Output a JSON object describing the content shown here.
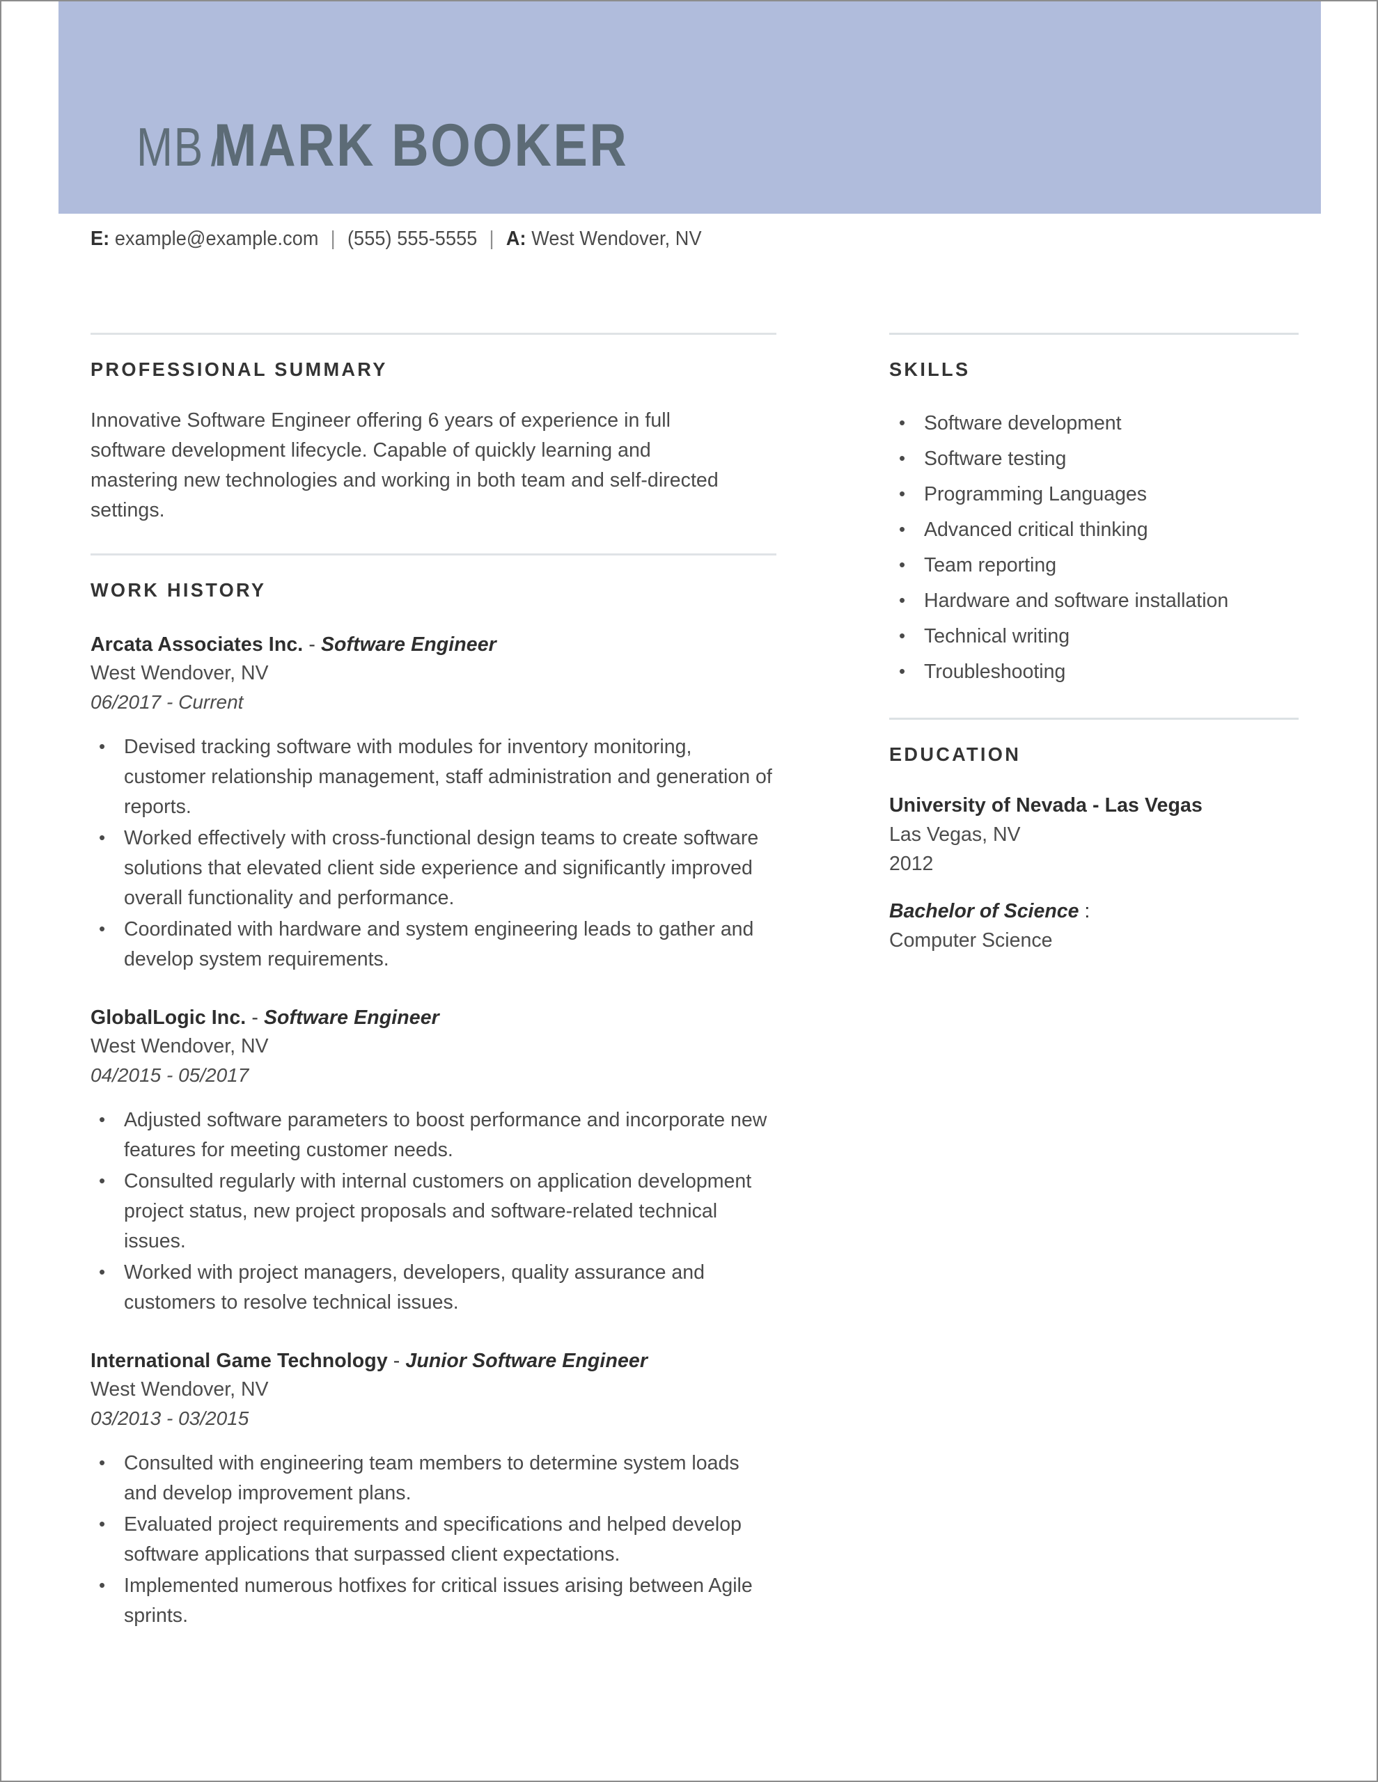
{
  "header": {
    "initials": "MB",
    "separator": "/",
    "full_name": "MARK BOOKER",
    "band_color": "#b0bcdc",
    "name_color": "#5c6b76"
  },
  "contact": {
    "email_label": "E:",
    "email": "example@example.com",
    "sep1": "|",
    "phone": "(555) 555-5555",
    "sep2": "|",
    "address_label": "A:",
    "address": "West Wendover, NV"
  },
  "sections": {
    "professional_summary": {
      "title": "PROFESSIONAL SUMMARY",
      "body": "Innovative Software Engineer offering 6 years of experience in full software development lifecycle. Capable of quickly learning and mastering new technologies and working in both team and self-directed settings."
    },
    "work_history": {
      "title": "WORK HISTORY",
      "jobs": [
        {
          "company": "Arcata Associates Inc.",
          "dash": " - ",
          "role": "Software Engineer",
          "location": "West Wendover, NV",
          "dates": "06/2017 - Current",
          "bullets": [
            "Devised tracking software with modules for inventory monitoring, customer relationship management, staff administration and generation of reports.",
            "Worked effectively with cross-functional design teams to create software solutions that elevated client side experience and significantly improved overall functionality and performance.",
            "Coordinated with hardware and system engineering leads to gather and develop system requirements."
          ]
        },
        {
          "company": "GlobalLogic Inc.",
          "dash": " - ",
          "role": "Software Engineer",
          "location": "West Wendover, NV",
          "dates": "04/2015 - 05/2017",
          "bullets": [
            "Adjusted software parameters to boost performance and incorporate new features for meeting customer needs.",
            "Consulted regularly with internal customers on application development project status, new project proposals and software-related technical issues.",
            "Worked with project managers, developers, quality assurance and customers to resolve technical issues."
          ]
        },
        {
          "company": "International Game Technology",
          "dash": " - ",
          "role": "Junior Software Engineer",
          "location": "West Wendover, NV",
          "dates": "03/2013 - 03/2015",
          "bullets": [
            "Consulted with engineering team members to determine system loads and develop improvement plans.",
            "Evaluated project requirements and specifications and helped develop software applications that surpassed client expectations.",
            "Implemented numerous hotfixes for critical issues arising between Agile sprints."
          ]
        }
      ]
    },
    "skills": {
      "title": "SKILLS",
      "items": [
        "Software development",
        "Software testing",
        "Programming Languages",
        "Advanced critical thinking",
        "Team reporting",
        "Hardware and software installation",
        "Technical writing",
        "Troubleshooting"
      ]
    },
    "education": {
      "title": "EDUCATION",
      "school": "University of Nevada - Las Vegas",
      "city": "Las Vegas, NV",
      "year": "2012",
      "degree": "Bachelor of Science",
      "degree_colon": " :",
      "major": "Computer Science"
    }
  }
}
